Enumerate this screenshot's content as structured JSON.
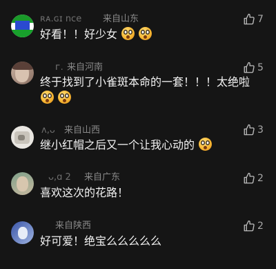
{
  "comments": [
    {
      "username": "ʀᴀ.ɢɪ nce",
      "location": "来自山东",
      "text": "好看！！好少女",
      "emoji_count": 2,
      "likes": "7"
    },
    {
      "username": "ᴦ.",
      "location": "来自河南",
      "text": "终于找到了小雀斑本命的一套！！！太绝啦",
      "emoji_count": 2,
      "likes": "5"
    },
    {
      "username": "ᴧ,ᴗ",
      "location": "来自山西",
      "text": "继小红帽之后又一个让我心动的",
      "emoji_count": 1,
      "likes": "3"
    },
    {
      "username": "ᴗ,ɑ 2",
      "location": "来自广东",
      "text": "喜欢这次的花路！",
      "emoji_count": 0,
      "likes": "2"
    },
    {
      "username": "",
      "location": "来自陕西",
      "text": "好可爱！绝宝么么么么么",
      "emoji_count": 0,
      "likes": "2"
    }
  ],
  "colors": {
    "background": "#151515",
    "text": "#f2f2f2",
    "meta": "#8a8a8a",
    "emoji": "#f7b733"
  },
  "icons": {
    "like": "thumbs-up-icon",
    "emoji": "astonished-face-emoji-icon"
  }
}
